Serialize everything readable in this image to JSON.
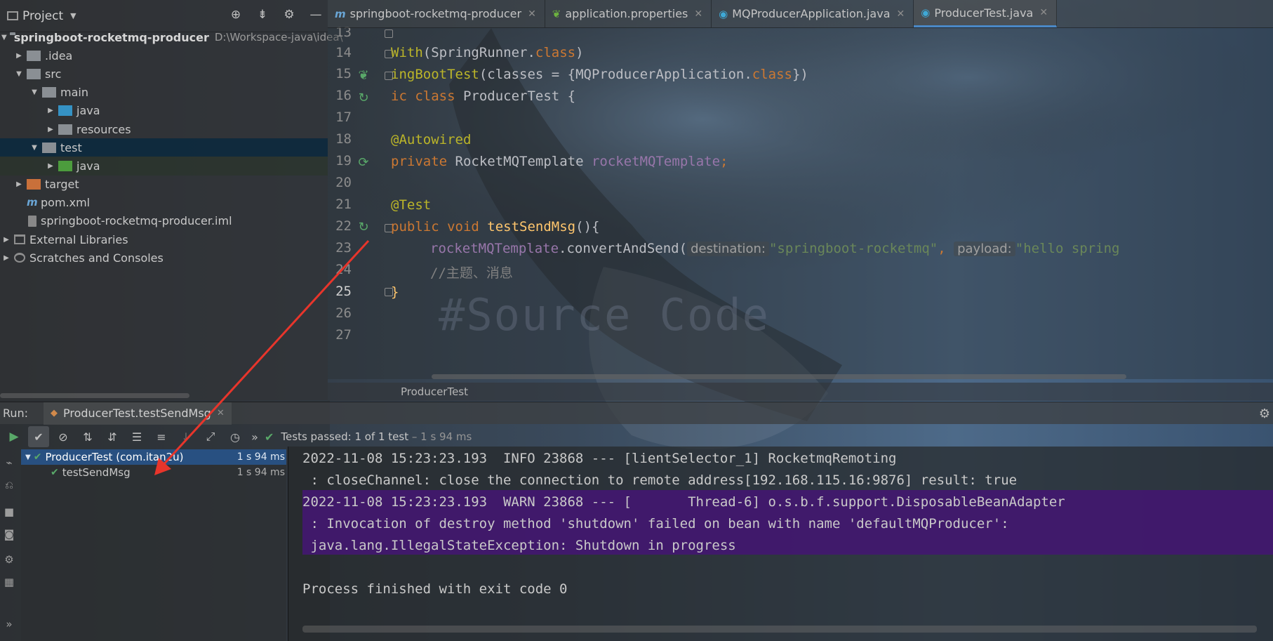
{
  "project": {
    "title": "Project",
    "tree": [
      {
        "label": "springboot-rocketmq-producer",
        "path": "D:\\Workspace-java\\idea\\"
      },
      {
        "label": ".idea"
      },
      {
        "label": "src"
      },
      {
        "label": "main"
      },
      {
        "label": "java"
      },
      {
        "label": "resources"
      },
      {
        "label": "test"
      },
      {
        "label": "java"
      },
      {
        "label": "target"
      },
      {
        "label": "pom.xml"
      },
      {
        "label": "springboot-rocketmq-producer.iml"
      },
      {
        "label": "External Libraries"
      },
      {
        "label": "Scratches and Consoles"
      }
    ]
  },
  "editor": {
    "tabs": [
      {
        "label": "springboot-rocketmq-producer",
        "icon": "m"
      },
      {
        "label": "application.properties",
        "icon": "leaf"
      },
      {
        "label": "MQProducerApplication.java",
        "icon": "class"
      },
      {
        "label": "ProducerTest.java",
        "icon": "class"
      }
    ],
    "line_numbers": [
      "13",
      "14",
      "15",
      "16",
      "17",
      "18",
      "19",
      "20",
      "21",
      "22",
      "23",
      "24",
      "25",
      "26",
      "27"
    ],
    "code": {
      "l14_a": "With",
      "l14_b": "(SpringRunner.",
      "l14_c": "class",
      "l14_d": ")",
      "l15_a": "ingBootTest",
      "l15_b": "(classes = {MQProducerApplication.",
      "l15_c": "class",
      "l15_d": "})",
      "l16_a": "ic ",
      "l16_b": "class ",
      "l16_c": "ProducerTest {",
      "l18": "@Autowired",
      "l19_a": "private ",
      "l19_b": "RocketMQTemplate ",
      "l19_c": "rocketMQTemplate",
      "l19_d": ";",
      "l21": "@Test",
      "l22_a": "public void ",
      "l22_b": "testSendMsg",
      "l22_c": "(){",
      "l23_a": "rocketMQTemplate",
      "l23_b": ".convertAndSend(",
      "l23_hint1": "destination:",
      "l23_c": "\"springboot-rocketmq\"",
      "l23_d": ", ",
      "l23_hint2": "payload:",
      "l23_e": "\"hello spring",
      "l24": "//主题、消息",
      "l25": "}"
    },
    "watermark": "#Source Code",
    "breadcrumb": "ProducerTest"
  },
  "run": {
    "label": "Run:",
    "tab_label": "ProducerTest.testSendMsg",
    "tests_passed_prefix": "Tests passed: ",
    "tests_passed_count": "1",
    "tests_passed_suffix": " of 1 test",
    "tests_passed_time": " – 1 s 94 ms",
    "test_tree": [
      {
        "label": "ProducerTest (com.itan2u)",
        "time": "1 s 94 ms"
      },
      {
        "label": "testSendMsg",
        "time": "1 s 94 ms"
      }
    ],
    "console": [
      "2022-11-08 15:23:23.193  INFO 23868 --- [lientSelector_1] RocketmqRemoting",
      " : closeChannel: close the connection to remote address[192.168.115.16:9876] result: true",
      "2022-11-08 15:23:23.193  WARN 23868 --- [       Thread-6] o.s.b.f.support.DisposableBeanAdapter",
      " : Invocation of destroy method 'shutdown' failed on bean with name 'defaultMQProducer':",
      " java.lang.IllegalStateException: Shutdown in progress",
      "Process finished with exit code 0"
    ]
  },
  "colors": {
    "accent": "#4a88c7",
    "selection": "#0d293e",
    "warn_bg": "#41186e",
    "pass_green": "#59a869",
    "arrow": "#e8352b"
  }
}
